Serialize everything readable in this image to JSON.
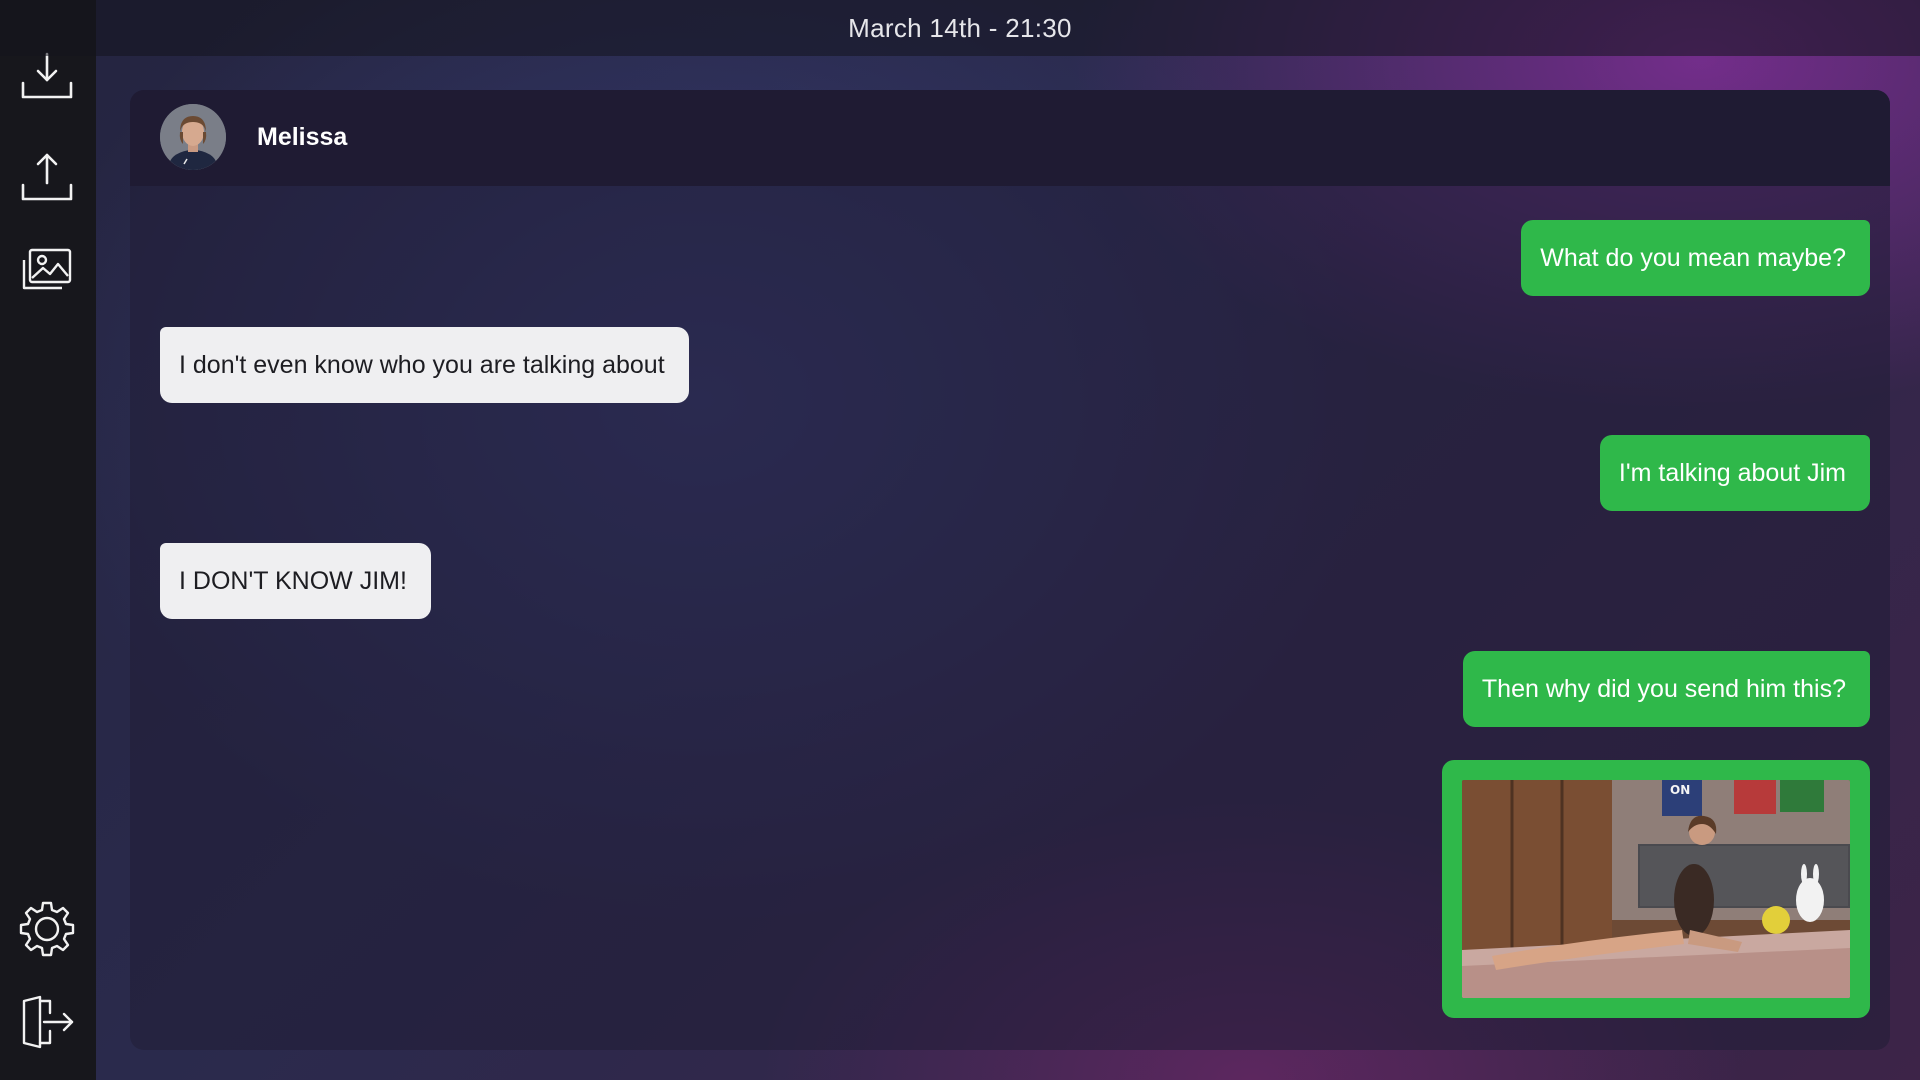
{
  "header": {
    "datetime": "March 14th - 21:30"
  },
  "sidebar": {
    "items": [
      {
        "name": "save",
        "icon": "download-icon"
      },
      {
        "name": "load",
        "icon": "upload-icon"
      },
      {
        "name": "gallery",
        "icon": "gallery-icon"
      },
      {
        "name": "settings",
        "icon": "gear-icon"
      },
      {
        "name": "exit",
        "icon": "exit-door-icon"
      }
    ]
  },
  "chat": {
    "contact_name": "Melissa",
    "avatar_icon": "contact-avatar",
    "messages": [
      {
        "direction": "outgoing",
        "text": "What do you mean maybe?"
      },
      {
        "direction": "incoming",
        "text": "I don't even know who you are talking about"
      },
      {
        "direction": "outgoing",
        "text": "I'm talking about Jim"
      },
      {
        "direction": "incoming",
        "text": "I DON'T KNOW JIM!"
      },
      {
        "direction": "outgoing",
        "text": "Then why did you send him this?"
      },
      {
        "direction": "outgoing",
        "type": "image",
        "poster_text": "ON"
      }
    ]
  },
  "colors": {
    "outgoing_bubble": "#2fb84a",
    "incoming_bubble": "#efeff1",
    "sidebar": "#17171c",
    "chat_header": "#1f1b33"
  }
}
